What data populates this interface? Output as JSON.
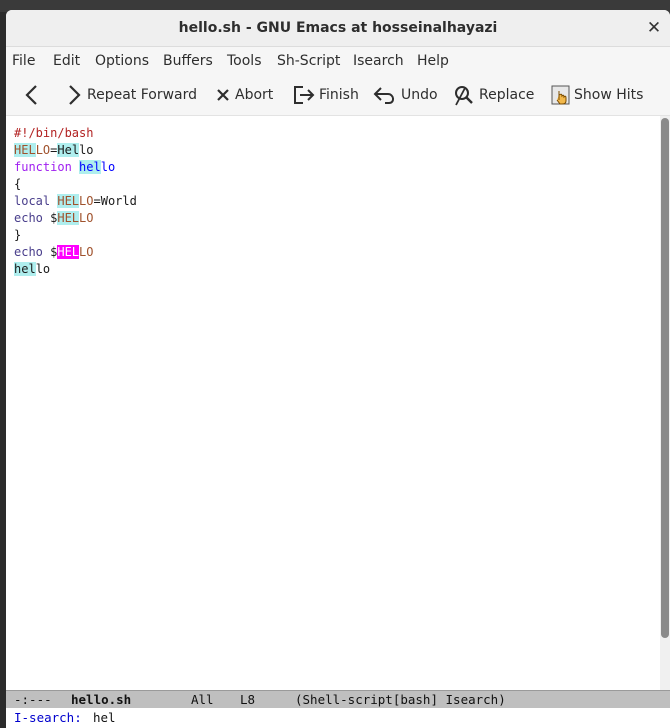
{
  "window": {
    "title": "hello.sh - GNU Emacs at hosseinalhayazi",
    "behind_title": "(partially hidden window title)"
  },
  "menubar": {
    "items": [
      "File",
      "Edit",
      "Options",
      "Buffers",
      "Tools",
      "Sh-Script",
      "Isearch",
      "Help"
    ]
  },
  "toolbar": {
    "back_icon": "chevron-left-icon",
    "repeat_forward": "Repeat Forward",
    "abort": "Abort",
    "finish": "Finish",
    "undo": "Undo",
    "replace": "Replace",
    "show_hits": "Show Hits"
  },
  "buffer": {
    "lines": [
      [
        {
          "t": "#!/bin/bash",
          "c": "comment"
        }
      ],
      [
        {
          "t": "HEL",
          "c": "var lazy"
        },
        {
          "t": "LO",
          "c": "var"
        },
        {
          "t": "="
        },
        {
          "t": "Hel",
          "c": "lazy"
        },
        {
          "t": "lo"
        }
      ],
      [
        {
          "t": "function",
          "c": "kw"
        },
        {
          "t": " "
        },
        {
          "t": "hel",
          "c": "fn lazy"
        },
        {
          "t": "lo",
          "c": "fn"
        }
      ],
      [
        {
          "t": "{"
        }
      ],
      [
        {
          "t": "local",
          "c": "builtin"
        },
        {
          "t": " "
        },
        {
          "t": "HEL",
          "c": "var lazy"
        },
        {
          "t": "LO",
          "c": "var"
        },
        {
          "t": "=World"
        }
      ],
      [
        {
          "t": "echo",
          "c": "builtin"
        },
        {
          "t": " $"
        },
        {
          "t": "HEL",
          "c": "var lazy"
        },
        {
          "t": "LO",
          "c": "var"
        }
      ],
      [
        {
          "t": "}"
        }
      ],
      [
        {
          "t": "echo",
          "c": "builtin"
        },
        {
          "t": " $"
        },
        {
          "t": "HEL",
          "c": "var cur"
        },
        {
          "t": "LO",
          "c": "var"
        }
      ],
      [
        {
          "t": "hel",
          "c": "lazy"
        },
        {
          "t": "lo"
        }
      ]
    ]
  },
  "modeline": {
    "status": "-:---",
    "buffer_name": "hello.sh",
    "position": "All",
    "line": "L8",
    "modes": "(Shell-script[bash] Isearch)"
  },
  "minibuffer": {
    "prompt": "I-search:",
    "text": "hel"
  },
  "colors": {
    "comment": "#b22222",
    "keyword": "#a020f0",
    "variable": "#a0522d",
    "function": "#0000ff",
    "builtin": "#483d8b",
    "lazy_highlight": "#afeeee",
    "current_match": "#ff00ff"
  }
}
